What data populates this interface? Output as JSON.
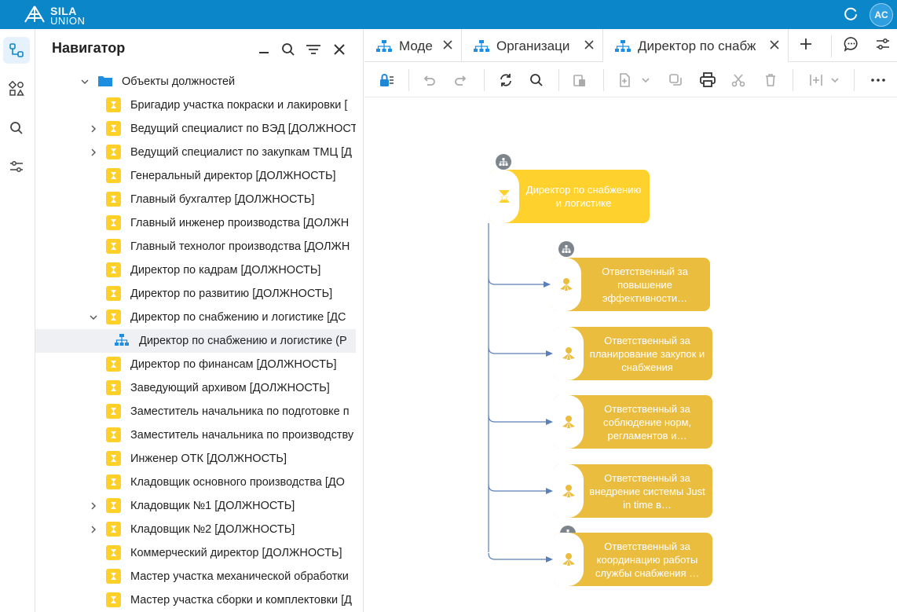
{
  "app": {
    "logo_line1": "SILA",
    "logo_line2": "UNION",
    "user_initials": "AC"
  },
  "colors": {
    "brand_bar": "#0b86c9",
    "position_yellow": "#ffd02a",
    "node_root": "#ffd12c",
    "node_child": "#ebbd3f",
    "connector": "#5b7fb8"
  },
  "navigator": {
    "title": "Навигатор",
    "items": [
      {
        "label": "Объекты должностей",
        "icon": "folder-icon",
        "expand": "expanded",
        "level": 0
      },
      {
        "label": "Бригадир участка покраски и лакировки [",
        "icon": "position-icon",
        "expand": "none",
        "level": 1
      },
      {
        "label": "Ведущий специалист по ВЭД [ДОЛЖНОСТ",
        "icon": "position-icon",
        "expand": "collapsed",
        "level": 1
      },
      {
        "label": "Ведущий специалист по закупкам ТМЦ [Д",
        "icon": "position-icon",
        "expand": "collapsed",
        "level": 1
      },
      {
        "label": "Генеральный директор [ДОЛЖНОСТЬ]",
        "icon": "position-icon",
        "expand": "none",
        "level": 1
      },
      {
        "label": "Главный бухгалтер [ДОЛЖНОСТЬ]",
        "icon": "position-icon",
        "expand": "none",
        "level": 1
      },
      {
        "label": "Главный инженер производства [ДОЛЖН",
        "icon": "position-icon",
        "expand": "none",
        "level": 1
      },
      {
        "label": "Главный технолог производства [ДОЛЖН",
        "icon": "position-icon",
        "expand": "none",
        "level": 1
      },
      {
        "label": "Директор по кадрам [ДОЛЖНОСТЬ]",
        "icon": "position-icon",
        "expand": "none",
        "level": 1
      },
      {
        "label": "Директор по развитию [ДОЛЖНОСТЬ]",
        "icon": "position-icon",
        "expand": "none",
        "level": 1
      },
      {
        "label": "Директор по снабжению и логистике [ДС",
        "icon": "position-icon",
        "expand": "expanded",
        "level": 1
      },
      {
        "label": "Директор по снабжению и логистике (Р",
        "icon": "org-chart-icon",
        "expand": "none",
        "level": 2,
        "selected": true
      },
      {
        "label": "Директор по финансам [ДОЛЖНОСТЬ]",
        "icon": "position-icon",
        "expand": "none",
        "level": 1
      },
      {
        "label": "Заведующий архивом [ДОЛЖНОСТЬ]",
        "icon": "position-icon",
        "expand": "none",
        "level": 1
      },
      {
        "label": "Заместитель начальника по подготовке п",
        "icon": "position-icon",
        "expand": "none",
        "level": 1
      },
      {
        "label": "Заместитель начальника по производству",
        "icon": "position-icon",
        "expand": "none",
        "level": 1
      },
      {
        "label": "Инженер ОТК [ДОЛЖНОСТЬ]",
        "icon": "position-icon",
        "expand": "none",
        "level": 1
      },
      {
        "label": "Кладовщик основного производства [ДО",
        "icon": "position-icon",
        "expand": "none",
        "level": 1
      },
      {
        "label": "Кладовщик №1 [ДОЛЖНОСТЬ]",
        "icon": "position-icon",
        "expand": "collapsed",
        "level": 1
      },
      {
        "label": "Кладовщик №2 [ДОЛЖНОСТЬ]",
        "icon": "position-icon",
        "expand": "collapsed",
        "level": 1
      },
      {
        "label": "Коммерческий директор [ДОЛЖНОСТЬ]",
        "icon": "position-icon",
        "expand": "none",
        "level": 1
      },
      {
        "label": "Мастер участка механической обработки",
        "icon": "position-icon",
        "expand": "none",
        "level": 1
      },
      {
        "label": "Мастер участка сборки и комплектовки [Д",
        "icon": "position-icon",
        "expand": "none",
        "level": 1
      }
    ]
  },
  "tabs": [
    {
      "label": "Моде",
      "icon": "org-chart-icon",
      "active": false
    },
    {
      "label": "Организаци",
      "icon": "org-chart-icon",
      "active": false
    },
    {
      "label": "Директор по снабж",
      "icon": "org-chart-icon",
      "active": true
    }
  ],
  "diagram": {
    "root": {
      "label": "Директор по снабжению и логистике",
      "icon": "position-star-icon"
    },
    "children": [
      {
        "label": "Ответственный за повышение эффективности…",
        "icon": "role-icon",
        "has_badge": true
      },
      {
        "label": "Ответственный за планирование закупок и снабжения",
        "icon": "role-icon",
        "has_badge": false
      },
      {
        "label": "Ответственный за соблюдение норм, регламентов и…",
        "icon": "role-icon",
        "has_badge": false
      },
      {
        "label": "Ответственный за внедрение системы Just in time в…",
        "icon": "role-icon",
        "has_badge": false
      },
      {
        "label": "Ответственный за координацию работы службы снабжения …",
        "icon": "role-icon",
        "has_badge": true
      }
    ]
  }
}
